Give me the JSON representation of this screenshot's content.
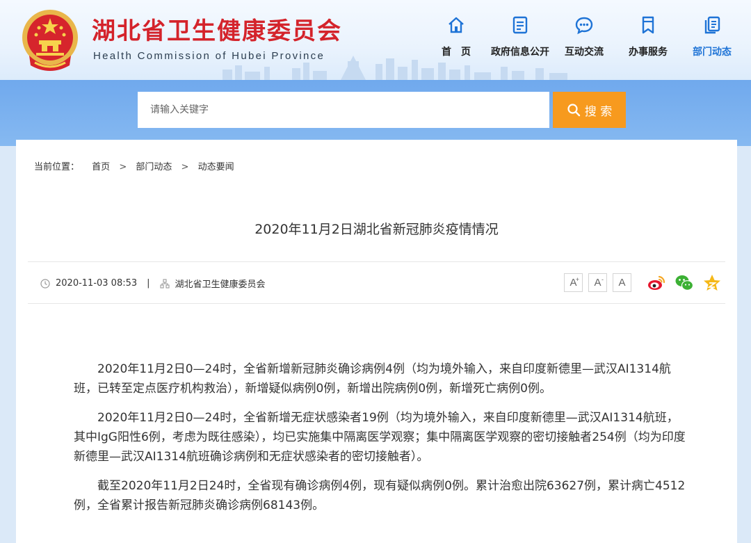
{
  "header": {
    "title": "湖北省卫生健康委员会",
    "subtitle": "Health Commission of Hubei Province",
    "colors": {
      "title": "#d4232b",
      "nav_active": "#1e73d6",
      "search_button": "#f79a1e"
    }
  },
  "nav": [
    {
      "label": "首　页",
      "icon": "home-icon"
    },
    {
      "label": "政府信息公开",
      "icon": "document-icon"
    },
    {
      "label": "互动交流",
      "icon": "chat-icon"
    },
    {
      "label": "办事服务",
      "icon": "bookmark-icon"
    },
    {
      "label": "部门动态",
      "icon": "copy-icon",
      "active": true
    }
  ],
  "search": {
    "placeholder": "请输入关键字",
    "button_label": "搜 索"
  },
  "breadcrumb": {
    "prefix": "当前位置：",
    "items": [
      "首页",
      "部门动态",
      "动态要闻"
    ],
    "separator": ">"
  },
  "article": {
    "title": "2020年11月2日湖北省新冠肺炎疫情情况",
    "date": "2020-11-03 08:53",
    "meta_separator": "|",
    "source": "湖北省卫生健康委员会",
    "font_buttons": [
      "A",
      "A",
      "A"
    ],
    "font_button_marks": [
      "+",
      "-"
    ],
    "share_icons": [
      "weibo-icon",
      "wechat-icon",
      "favorite-star-icon"
    ],
    "paragraphs": [
      "2020年11月2日0—24时，全省新增新冠肺炎确诊病例4例（均为境外输入，来自印度新德里—武汉AI1314航班，已转至定点医疗机构救治），新增疑似病例0例，新增出院病例0例，新增死亡病例0例。",
      "2020年11月2日0—24时，全省新增无症状感染者19例（均为境外输入，来自印度新德里—武汉AI1314航班，其中IgG阳性6例，考虑为既往感染），均已实施集中隔离医学观察；集中隔离医学观察的密切接触者254例（均为印度新德里—武汉AI1314航班确诊病例和无症状感染者的密切接触者）。",
      "截至2020年11月2日24时，全省现有确诊病例4例，现有疑似病例0例。累计治愈出院63627例，累计病亡4512例，全省累计报告新冠肺炎确诊病例68143例。"
    ]
  }
}
